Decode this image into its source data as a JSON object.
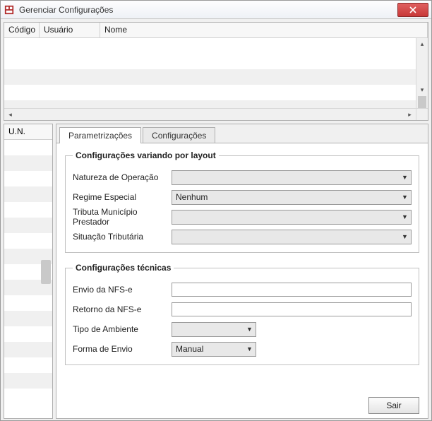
{
  "titlebar": {
    "title": "Gerenciar Configurações"
  },
  "grid": {
    "columns": {
      "codigo": "Código",
      "usuario": "Usuário",
      "nome": "Nome"
    }
  },
  "un_panel": {
    "header": "U.N."
  },
  "tabs": {
    "parametrizacoes": "Parametrizações",
    "configuracoes": "Configurações"
  },
  "group_layout": {
    "legend": "Configurações variando por layout",
    "fields": {
      "natureza_operacao": {
        "label": "Natureza de Operação",
        "value": ""
      },
      "regime_especial": {
        "label": "Regime Especial",
        "value": "Nenhum"
      },
      "tributa_municipio": {
        "label": "Tributa Município Prestador",
        "value": ""
      },
      "situacao_tributaria": {
        "label": "Situação Tributária",
        "value": ""
      }
    }
  },
  "group_tecnicas": {
    "legend": "Configurações técnicas",
    "fields": {
      "envio_nfse": {
        "label": "Envio da NFS-e",
        "value": ""
      },
      "retorno_nfse": {
        "label": "Retorno da NFS-e",
        "value": ""
      },
      "tipo_ambiente": {
        "label": "Tipo de Ambiente",
        "value": ""
      },
      "forma_envio": {
        "label": "Forma de Envio",
        "value": "Manual"
      }
    }
  },
  "footer": {
    "sair": "Sair"
  }
}
